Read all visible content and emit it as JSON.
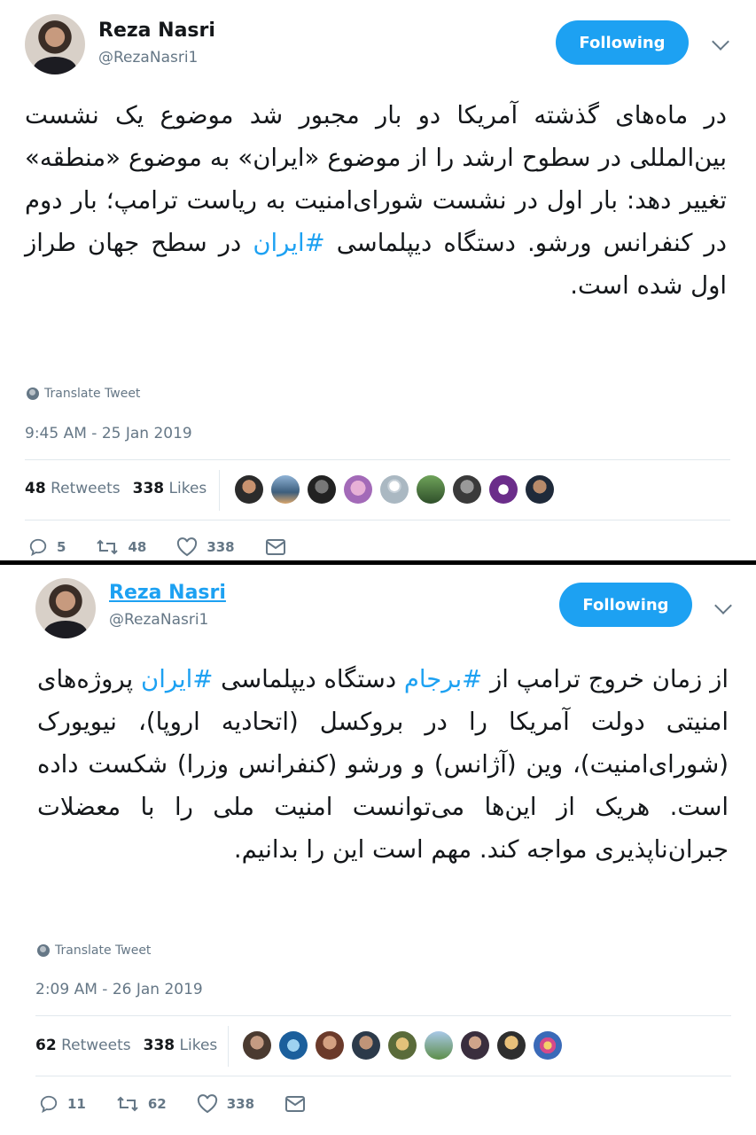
{
  "tweets": [
    {
      "author_name": "Reza Nasri",
      "author_handle": "@RezaNasri1",
      "follow_label": "Following",
      "body_before": "در ماه‌های گذشته آمریکا دو بار مجبور شد موضوع یک نشست بین‌المللی در سطوح ارشد را از موضوع «ایران» به موضوع «منطقه» تغییر دهد: بار اول در نشست شورای‌امنیت به ریاست ترامپ؛ بار دوم در کنفرانس ورشو. دستگاه دیپلماسی ",
      "hashtag": "#ایران",
      "body_after": " در سطح جهان طراز اول شده است.",
      "translate_label": "Translate Tweet",
      "timestamp": "9:45 AM - 25 Jan 2019",
      "retweets_count": "48",
      "retweets_label": "Retweets",
      "likes_count": "338",
      "likes_label": "Likes",
      "reply_count": "5",
      "retweet_action_count": "48",
      "like_action_count": "338"
    },
    {
      "author_name": "Reza Nasri",
      "author_handle": "@RezaNasri1",
      "follow_label": "Following",
      "body_p1": "از زمان خروج ترامپ از ",
      "hashtag1": "#برجام",
      "body_p2": " دستگاه دیپلماسی ",
      "hashtag2": "#ایران",
      "body_p3": " پروژه‌های امنیتی دولت آمریکا را در بروکسل (اتحادیه اروپا)، نیویورک (شورای‌امنیت)، وین (آژانس) و ورشو (کنفرانس وزرا) شکست داده است. هریک از این‌ها می‌توانست امنیت ملی را با معضلات جبران‌ناپذیری مواجه کند. مهم است این را بدانیم.",
      "translate_label": "Translate Tweet",
      "timestamp": "2:09 AM - 26 Jan 2019",
      "retweets_count": "62",
      "retweets_label": "Retweets",
      "likes_count": "338",
      "likes_label": "Likes",
      "reply_count": "11",
      "retweet_action_count": "62",
      "like_action_count": "338"
    }
  ],
  "colors": {
    "accent": "#1da1f2",
    "muted": "#657786",
    "text": "#14171a",
    "divider": "#e1e8ed"
  }
}
